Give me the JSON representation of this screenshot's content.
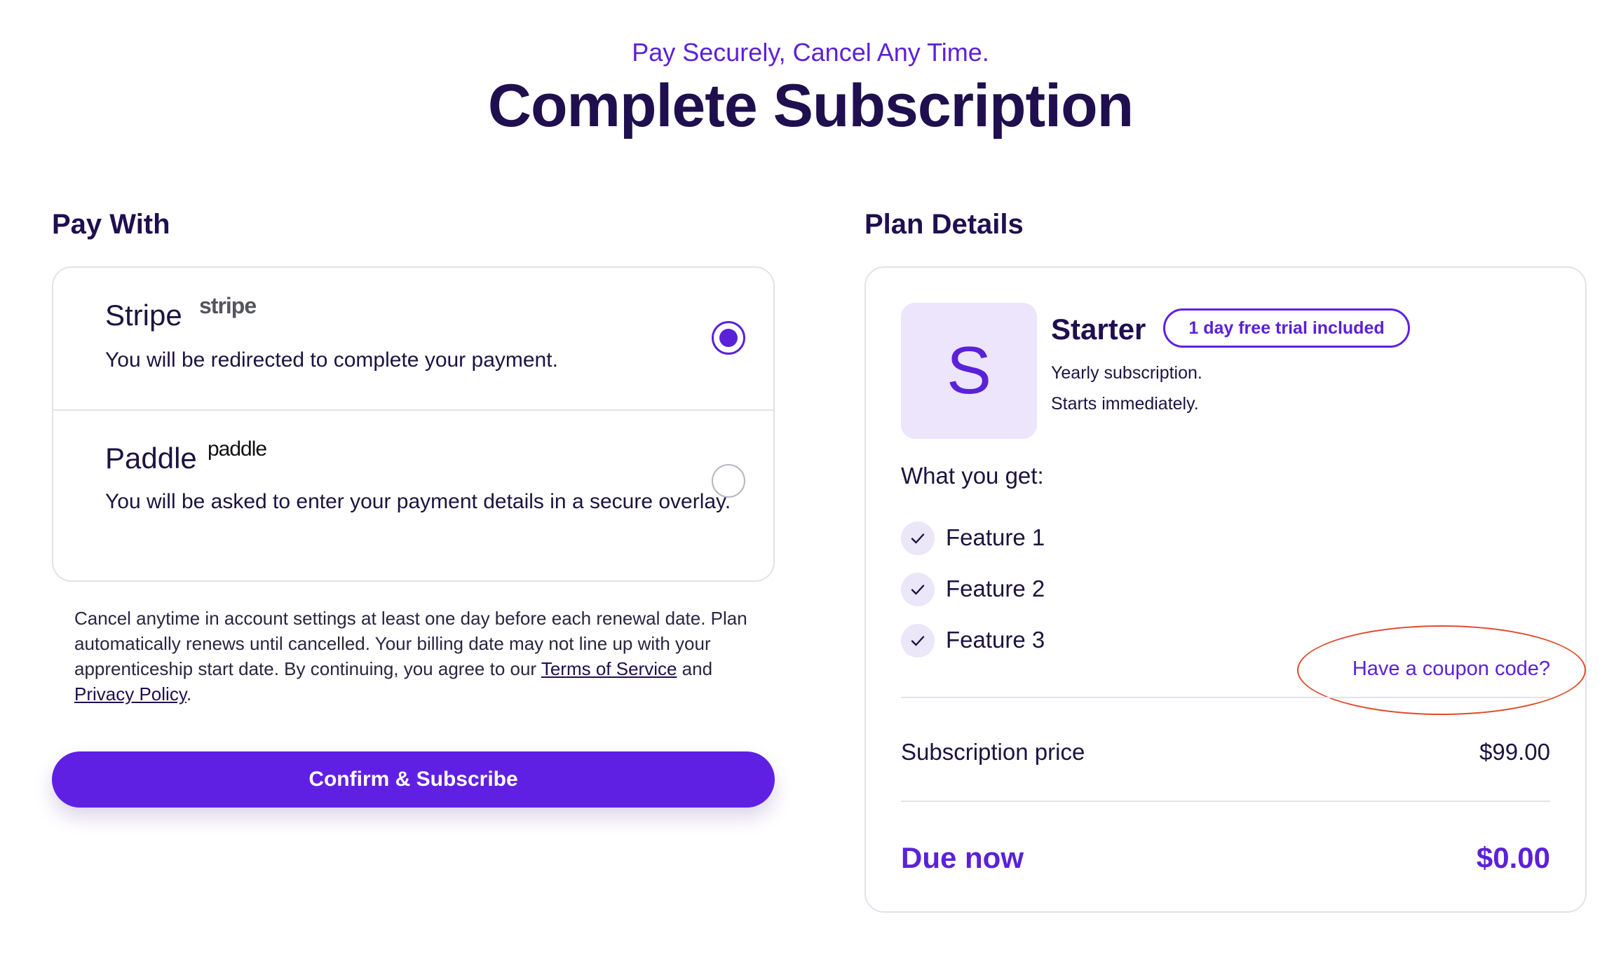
{
  "header": {
    "tagline": "Pay Securely, Cancel Any Time.",
    "title": "Complete Subscription"
  },
  "pay_with": {
    "heading": "Pay With",
    "options": [
      {
        "name": "Stripe",
        "logo_text": "stripe",
        "description": "You will be redirected to complete your payment.",
        "selected": true
      },
      {
        "name": "Paddle",
        "logo_text": "paddle",
        "description": "You will be asked to enter your payment details in a secure overlay.",
        "selected": false
      }
    ],
    "legal": {
      "text_before": "Cancel anytime in account settings at least one day before each renewal date. Plan automatically renews until cancelled. Your billing date may not line up with your apprenticeship start date. By continuing, you agree to our ",
      "terms_link": "Terms of Service",
      "text_middle": " and ",
      "privacy_link": "Privacy Policy",
      "text_after": "."
    },
    "confirm_button": "Confirm & Subscribe"
  },
  "plan_details": {
    "heading": "Plan Details",
    "avatar_letter": "S",
    "plan_name": "Starter",
    "trial_badge": "1 day free trial included",
    "meta": [
      "Yearly subscription.",
      "Starts immediately."
    ],
    "what_you_get": "What you get:",
    "features": [
      "Feature 1",
      "Feature 2",
      "Feature 3"
    ],
    "coupon_link": "Have a coupon code?",
    "subscription_price_label": "Subscription price",
    "subscription_price": "$99.00",
    "due_now_label": "Due now",
    "due_now": "$0.00"
  },
  "colors": {
    "accent": "#6020e3",
    "heading": "#1f0f4f",
    "annotation_ring": "#e04a2a"
  }
}
